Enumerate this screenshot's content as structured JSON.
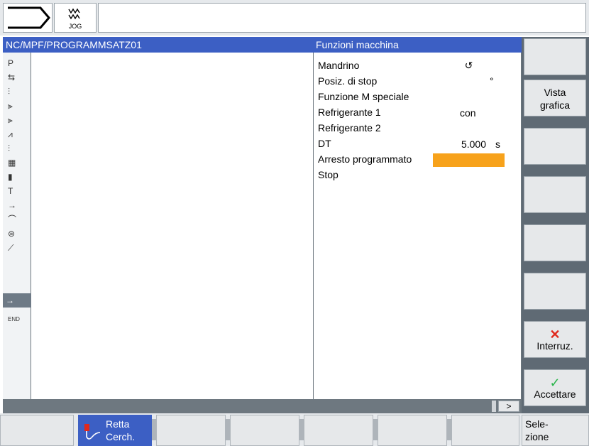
{
  "topbar": {
    "mode_label": "JOG"
  },
  "header": {
    "path": "NC/MPF/PROGRAMMSATZ01",
    "title": "Funzioni macchina"
  },
  "left_icons": [
    "P",
    "⇆",
    "⫶",
    "⫸",
    "⫸",
    "⩘",
    "⫶",
    "▦",
    "▮",
    "T",
    "→",
    "⌒",
    "⊜",
    "⟋",
    "→",
    "END"
  ],
  "params": [
    {
      "label": "Mandrino",
      "value": "↺",
      "unit": ""
    },
    {
      "label": "Posiz. di stop",
      "value": "",
      "unit": "°"
    },
    {
      "label": "Funzione M speciale",
      "value": "",
      "unit": ""
    },
    {
      "label": "Refrigerante 1",
      "value": "con",
      "unit": ""
    },
    {
      "label": "Refrigerante 2",
      "value": "",
      "unit": ""
    },
    {
      "label": "DT",
      "value": "5.000",
      "unit": "s"
    },
    {
      "label": "Arresto programmato",
      "value": "",
      "unit": ""
    },
    {
      "label": "Stop",
      "value": "",
      "unit": ""
    }
  ],
  "status": {
    "more_label": ">"
  },
  "softkeys_right": {
    "vista_line1": "Vista",
    "vista_line2": "grafica",
    "cancel": "Interruz.",
    "accept": "Accettare"
  },
  "softkeys_bottom": {
    "retta_line1": "Retta",
    "retta_line2": "Cerch.",
    "sel_line1": "Sele-",
    "sel_line2": "zione"
  },
  "colors": {
    "header": "#3c5fc4",
    "highlight": "#f7a21b",
    "accept": "#2bb54c",
    "cancel": "#e0281c"
  }
}
